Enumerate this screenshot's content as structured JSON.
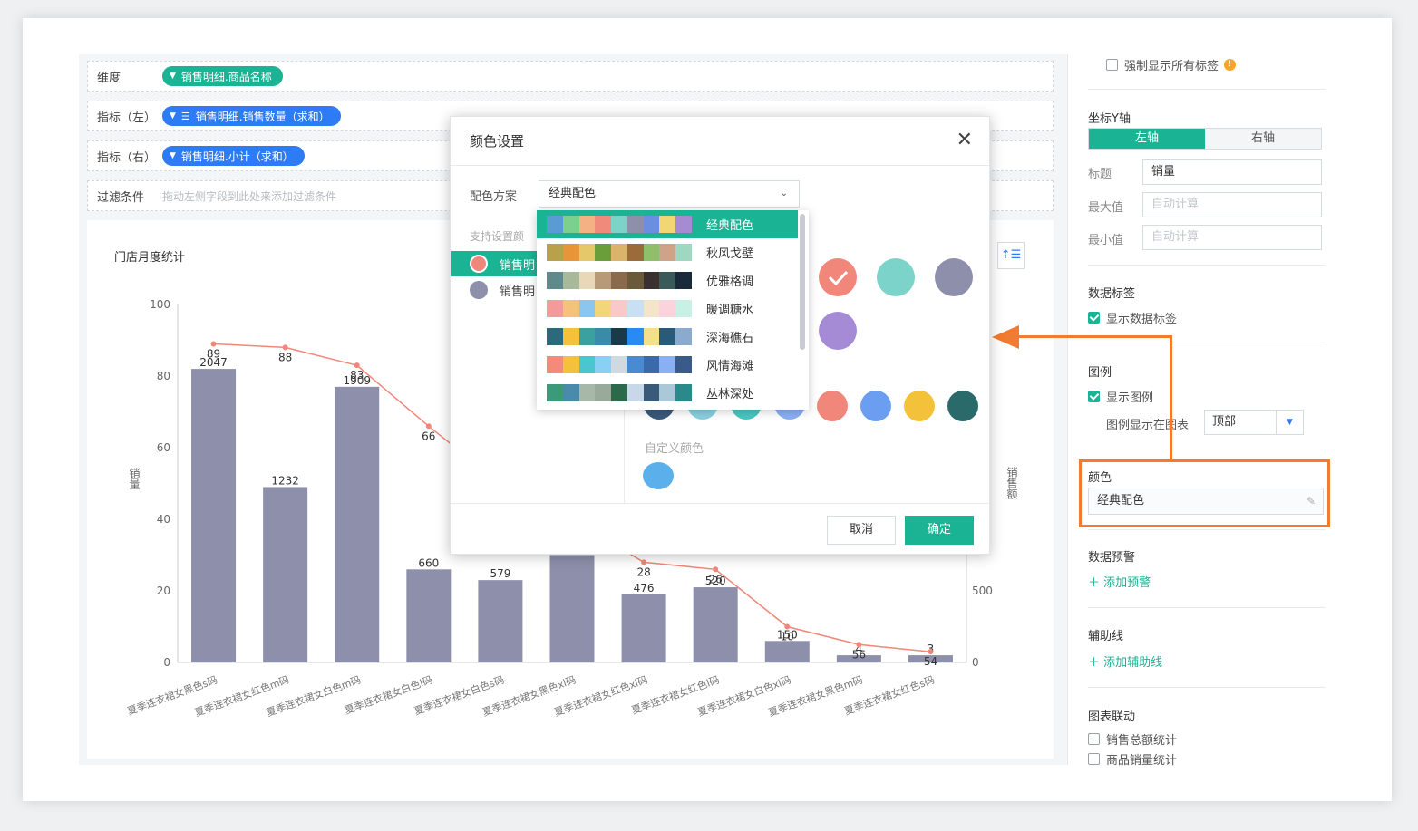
{
  "fields": {
    "dimension_label": "维度",
    "dimension_pill": "销售明细.商品名称",
    "left_metric_label": "指标（左）",
    "left_metric_pill": "销售明细.销售数量（求和）",
    "right_metric_label": "指标（右）",
    "right_metric_pill": "销售明细.小计（求和）",
    "filter_label": "过滤条件",
    "filter_placeholder": "拖动左侧字段到此处来添加过滤条件"
  },
  "chart_data": {
    "type": "bar",
    "title": "门店月度统计",
    "categories": [
      "夏季连衣裙女黑色s码",
      "夏季连衣裙女红色m码",
      "夏季连衣裙女白色m码",
      "夏季连衣裙女白色l码",
      "夏季连衣裙女白色s码",
      "夏季连衣裙女黑色xl码",
      "夏季连衣裙女红色xl码",
      "夏季连衣裙女红色l码",
      "夏季连衣裙女白色xl码",
      "夏季连衣裙女黑色m码",
      "夏季连衣裙女红色s码"
    ],
    "series": [
      {
        "name": "销售数量",
        "axis": "left",
        "type": "bar",
        "values": [
          82,
          49,
          77,
          26,
          23,
          30,
          19,
          21,
          6,
          2,
          2
        ],
        "labels": [
          "2047",
          "1232",
          "1909",
          "660",
          "579",
          "",
          "476",
          "520",
          "150",
          "4",
          "3"
        ]
      },
      {
        "name": "小计",
        "axis": "left",
        "type": "line",
        "values": [
          89,
          88,
          83,
          66,
          50,
          40,
          28,
          26,
          10,
          5,
          3
        ],
        "labels": [
          "89",
          "88",
          "83",
          "66",
          "",
          "",
          "28",
          "26",
          "10",
          "56",
          "54"
        ]
      }
    ],
    "ylabel_left": "销量",
    "ylabel_right": "销售额",
    "y_left_ticks": [
      "100",
      "80",
      "60",
      "40",
      "20",
      "0"
    ],
    "y_right_ticks": [
      "500",
      "0"
    ],
    "ylim": [
      0,
      100
    ],
    "colors": {
      "bar": "#8e90ab",
      "line": "#f0877a"
    }
  },
  "chart_ui": {
    "sort_icon": "sort-asc-icon"
  },
  "sidebar": {
    "force_labels": "强制显示所有标签",
    "yaxis_title": "坐标Y轴",
    "axis_tabs": [
      "左轴",
      "右轴"
    ],
    "title_label": "标题",
    "title_value": "销量",
    "max_label": "最大值",
    "max_placeholder": "自动计算",
    "min_label": "最小值",
    "min_placeholder": "自动计算",
    "data_label_title": "数据标签",
    "show_data_label": "显示数据标签",
    "legend_title": "图例",
    "show_legend": "显示图例",
    "legend_pos_label": "图例显示在图表",
    "legend_pos_value": "顶部",
    "color_title": "颜色",
    "color_value": "经典配色",
    "alert_title": "数据预警",
    "add_alert": "添加预警",
    "aux_title": "辅助线",
    "add_aux": "添加辅助线",
    "link_title": "图表联动",
    "link_items": [
      "销售总额统计",
      "商品销量统计"
    ]
  },
  "modal": {
    "title": "颜色设置",
    "scheme_label": "配色方案",
    "scheme_value": "经典配色",
    "support_label": "支持设置颜",
    "series_items": [
      {
        "label": "销售明",
        "color": "#f0877a"
      },
      {
        "label": "销售明",
        "color": "#8e90ab"
      }
    ],
    "custom_label": "自定义颜色",
    "cancel": "取消",
    "ok": "确定"
  },
  "schemes": [
    {
      "name": "经典配色",
      "colors": [
        "#5b9bd5",
        "#7ccf8c",
        "#f4b183",
        "#f08a7a",
        "#7cd3c9",
        "#8e90ab",
        "#6b8fe0",
        "#f1d673",
        "#a58ad6"
      ]
    },
    {
      "name": "秋风戈壁",
      "colors": [
        "#b8a14a",
        "#e8953a",
        "#e5c86a",
        "#6a9e3a",
        "#d9b46a",
        "#9c6b3a",
        "#8fbf6a",
        "#cfa28a",
        "#9fd7c0"
      ]
    },
    {
      "name": "优雅格调",
      "colors": [
        "#5f8a8b",
        "#a8b89a",
        "#e8d8b8",
        "#b89a78",
        "#8a6a4a",
        "#6a5a3a",
        "#3a3030",
        "#3a5a5a",
        "#1a2a3a"
      ]
    },
    {
      "name": "暖调糖水",
      "colors": [
        "#f49a9a",
        "#f4c27a",
        "#8ac6f0",
        "#f4d67a",
        "#f9c9c9",
        "#c9e0f4",
        "#f4e4c9",
        "#fbd3dc",
        "#c9f0e4"
      ]
    },
    {
      "name": "深海礁石",
      "colors": [
        "#2a6a7a",
        "#f4c23a",
        "#3aa0a0",
        "#3a8aaa",
        "#1a3a4a",
        "#2a8af4",
        "#f4e08a",
        "#2a5a7a",
        "#8aaad0"
      ]
    },
    {
      "name": "风情海滩",
      "colors": [
        "#f48a7a",
        "#f4c23a",
        "#4ac6d0",
        "#8ad0f4",
        "#d0d8e0",
        "#4a8ad0",
        "#3a6aaa",
        "#8ab0f4",
        "#3a5a8a"
      ]
    },
    {
      "name": "丛林深处",
      "colors": [
        "#3a9a7a",
        "#4a8aaa",
        "#a8b8a8",
        "#9aaa9a",
        "#2a6a4a",
        "#c8d8e8",
        "#3a5a7a",
        "#aac8d8",
        "#2a8a8a"
      ]
    }
  ],
  "palette_circles": [
    "#f0877a",
    "#7cd3c9",
    "#8e90ab",
    "#a58ad6",
    "#f0877a",
    "#6b9ef0",
    "#f4c23a",
    "#2a6a6a",
    "#3a5a7a",
    "#8ad0e0",
    "#4ac6c0",
    "#8ab0f4",
    "#5b9bd5"
  ]
}
